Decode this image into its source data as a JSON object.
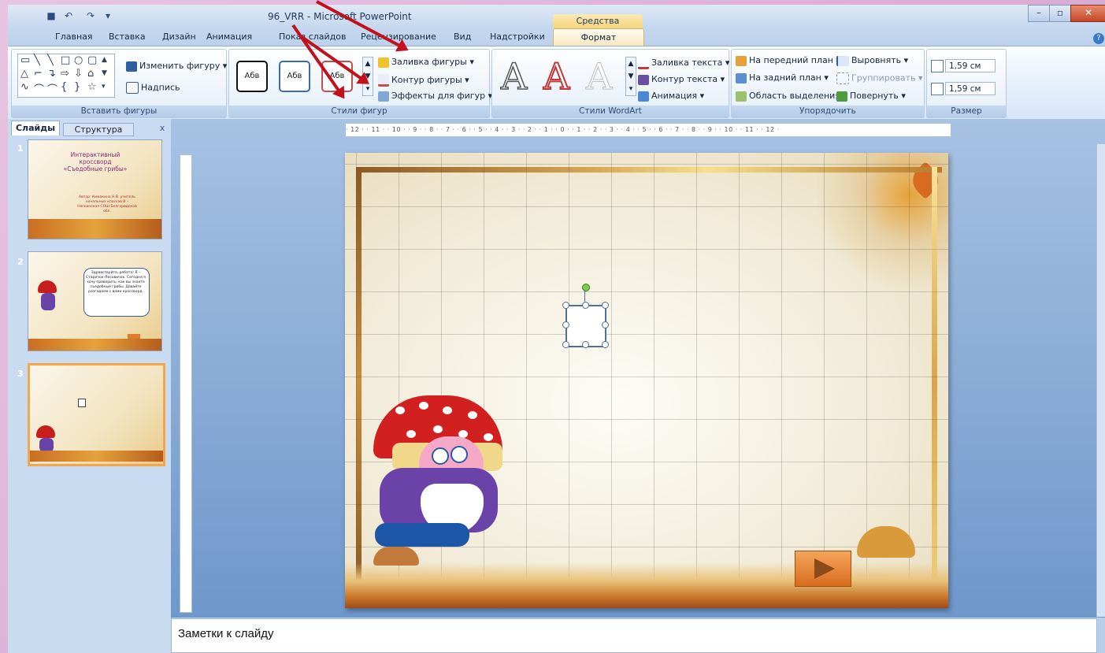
{
  "window": {
    "title": "96_VRR - Microsoft PowerPoint",
    "context_group": "Средства рисования",
    "min_label": "–",
    "max_label": "▫",
    "close_label": "✕"
  },
  "qat": {
    "save": "■",
    "undo": "↶",
    "redo": "↷",
    "customize": "▾"
  },
  "tabs": [
    "Главная",
    "Вставка",
    "Дизайн",
    "Анимация",
    "Показ слайдов",
    "Рецензирование",
    "Вид",
    "Надстройки",
    "Формат"
  ],
  "help": "?",
  "ribbon": {
    "insert_shapes": {
      "change_shape": "Изменить фигуру ▾",
      "textbox": "Надпись",
      "label": "Вставить фигуры"
    },
    "shape_styles": {
      "thumb_label": "Абв",
      "fill": "Заливка фигуры ▾",
      "outline": "Контур фигуры ▾",
      "effects": "Эффекты для фигур ▾",
      "label": "Стили фигур"
    },
    "wordart": {
      "letter": "A",
      "text_fill": "Заливка текста ▾",
      "text_outline": "Контур текста ▾",
      "animation": "Анимация ▾",
      "label": "Стили WordArt"
    },
    "arrange": {
      "front": "На передний план ▾",
      "back": "На задний план ▾",
      "selection": "Область выделения",
      "align": "Выровнять ▾",
      "group": "Группировать ▾",
      "rotate": "Повернуть ▾",
      "label": "Упорядочить"
    },
    "size": {
      "height": "1,59 см",
      "width": "1,59 см",
      "label": "Размер"
    }
  },
  "panel": {
    "tab_slides": "Слайды",
    "tab_outline": "Структура",
    "close": "x",
    "slides": [
      {
        "num": "1",
        "title": "Интерактивный кроссворд «Съедобные грибы»",
        "author": "Автор: Кимакина Н.В. учитель начальных классов В – Няскинская СОШ Белгородской обл."
      },
      {
        "num": "2",
        "bubble": "Здравствуйте, ребята! Я – Старичок-Лесовичок. Сегодня я хочу проверить, как вы знаете съедобные грибы. Давайте разгадаем с вами кроссворд."
      },
      {
        "num": "3"
      }
    ]
  },
  "ruler_h": "· 12 · · 11 · · 10 · · 9 · · 8 · · 7 · · 6 · · 5 · · 4 · · 3 · · 2 · · 1 · · 0 · · 1 · · 2 · · 3 · · 4 · · 5 · · 6 · · 7 · · 8 · · 9 · · 10 · · 11 · · 12 ·",
  "notes_placeholder": "Заметки к слайду"
}
